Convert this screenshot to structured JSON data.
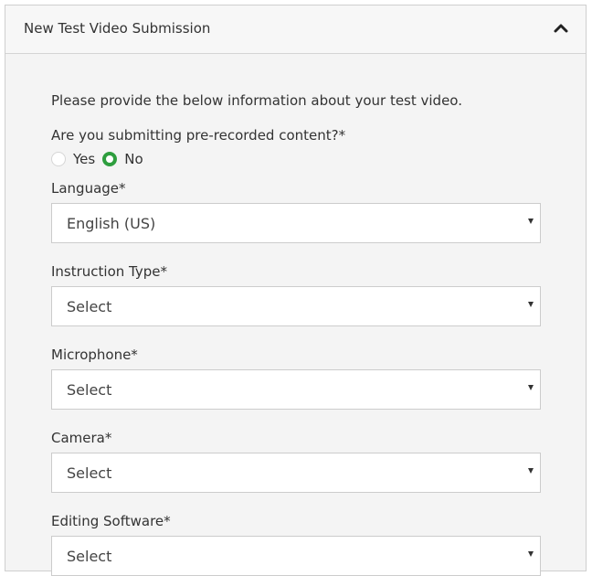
{
  "panel": {
    "title": "New Test Video Submission",
    "toggle_icon": "chevron-up-icon"
  },
  "form": {
    "intro": "Please provide the below information about your test video.",
    "prerecorded": {
      "label": "Are you submitting pre-recorded content?*",
      "options": [
        {
          "label": "Yes",
          "selected": false
        },
        {
          "label": "No",
          "selected": true
        }
      ]
    },
    "fields": [
      {
        "label": "Language*",
        "value": "English (US)"
      },
      {
        "label": "Instruction Type*",
        "value": "Select"
      },
      {
        "label": "Microphone*",
        "value": "Select"
      },
      {
        "label": "Camera*",
        "value": "Select"
      },
      {
        "label": "Editing Software*",
        "value": "Select"
      }
    ]
  },
  "colors": {
    "accent": "#2e9e3e",
    "panel_bg": "#f4f4f4",
    "border": "#cfcfcf"
  }
}
